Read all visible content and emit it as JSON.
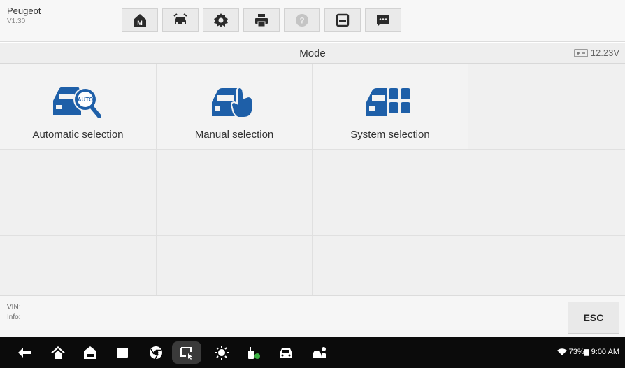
{
  "app": {
    "name": "Peugeot",
    "version": "V1.30"
  },
  "toolbar": {
    "tools": [
      {
        "name": "home",
        "icon": "home-icon"
      },
      {
        "name": "vehicle-swap",
        "icon": "car-swap-icon"
      },
      {
        "name": "settings",
        "icon": "gear-icon"
      },
      {
        "name": "print",
        "icon": "printer-icon"
      },
      {
        "name": "help",
        "icon": "help-icon"
      },
      {
        "name": "save",
        "icon": "save-icon"
      },
      {
        "name": "data-logging",
        "icon": "message-icon"
      }
    ]
  },
  "header": {
    "title": "Mode",
    "voltage": "12.23V"
  },
  "modes": [
    {
      "label": "Automatic selection",
      "icon": "car-auto-search-icon"
    },
    {
      "label": "Manual selection",
      "icon": "car-hand-icon"
    },
    {
      "label": "System selection",
      "icon": "car-system-grid-icon"
    }
  ],
  "footer": {
    "vin_label": "VIN:",
    "info_label": "Info:",
    "esc_label": "ESC"
  },
  "navbar": {
    "items": [
      "back-icon",
      "home-icon",
      "garage-icon",
      "recent-apps-icon",
      "browser-icon",
      "screenshot-icon",
      "brightness-icon",
      "vci-icon",
      "car-icon",
      "user-car-icon"
    ],
    "status": {
      "battery": "73%",
      "time": "9:00 AM"
    }
  },
  "colors": {
    "accent": "#1e5fa8",
    "toolbar_bg": "#f7f7f7",
    "nav_bg": "#0b0b0b"
  }
}
